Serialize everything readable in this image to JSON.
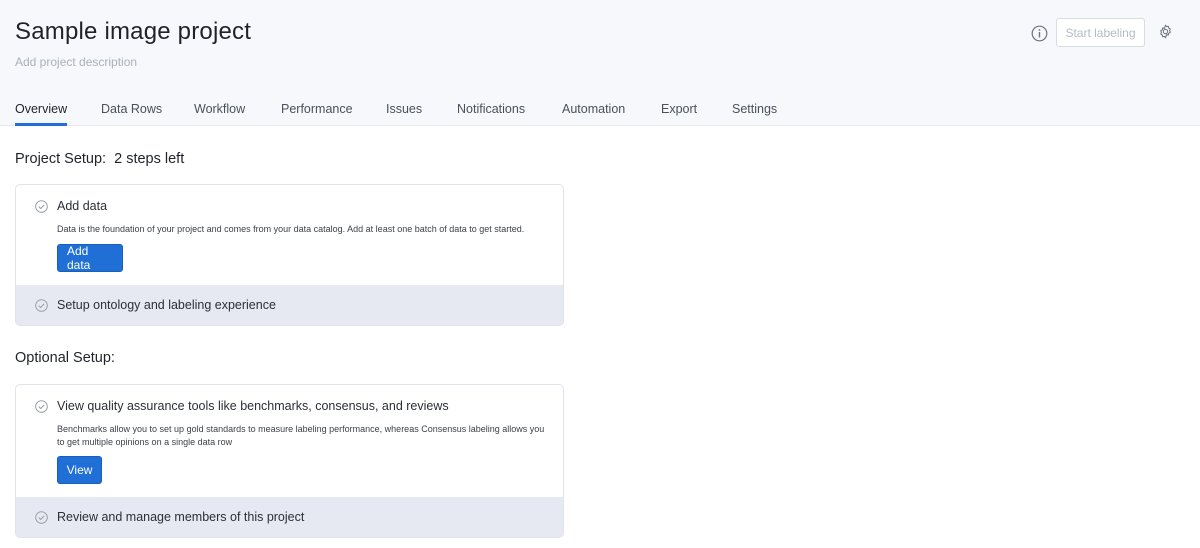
{
  "project": {
    "title": "Sample image project",
    "description_placeholder": "Add project description"
  },
  "header": {
    "start_labeling_label": "Start labeling",
    "icons": [
      "info-icon",
      "gear-icon"
    ]
  },
  "tabs": [
    {
      "label": "Overview",
      "active": true
    },
    {
      "label": "Data Rows"
    },
    {
      "label": "Workflow"
    },
    {
      "label": "Performance"
    },
    {
      "label": "Issues"
    },
    {
      "label": "Notifications"
    },
    {
      "label": "Automation"
    },
    {
      "label": "Export"
    },
    {
      "label": "Settings"
    }
  ],
  "project_setup": {
    "title": "Project Setup:",
    "steps_left": "2 steps left",
    "steps": [
      {
        "title": "Add data",
        "description": "Data is the foundation of your project and comes from your data catalog. Add at least one batch of data to get started.",
        "button": "Add data",
        "expanded": true
      },
      {
        "title": "Setup ontology and labeling experience",
        "expanded": false
      }
    ]
  },
  "optional_setup": {
    "title": "Optional Setup:",
    "steps": [
      {
        "title": "View quality assurance tools like benchmarks, consensus, and reviews",
        "description": "Benchmarks allow you to set up gold standards to measure labeling performance, whereas Consensus labeling allows you to get multiple opinions on a single data row",
        "button": "View",
        "expanded": true
      },
      {
        "title": "Review and manage members of this project",
        "expanded": false
      }
    ]
  },
  "colors": {
    "primary": "#1f6fd6",
    "header_bg": "#f7f8fb",
    "collapsed_row_bg": "#e6e9f1"
  }
}
